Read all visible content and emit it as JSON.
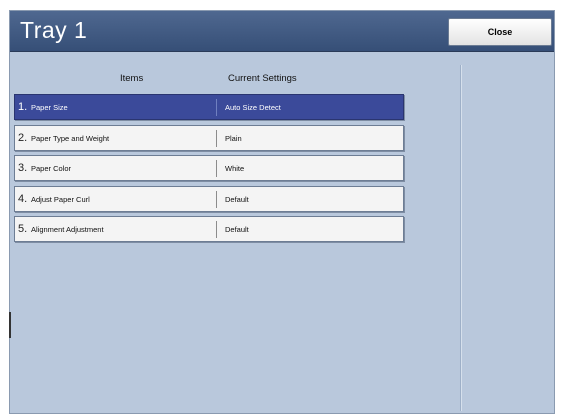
{
  "window": {
    "title": "Tray 1"
  },
  "toolbar": {
    "close_label": "Close"
  },
  "table": {
    "header_items": "Items",
    "header_current": "Current Settings",
    "rows": [
      {
        "num": "1.",
        "name": "Paper Size",
        "value": "Auto Size Detect",
        "selected": true
      },
      {
        "num": "2.",
        "name": "Paper Type and Weight",
        "value": "Plain",
        "selected": false
      },
      {
        "num": "3.",
        "name": "Paper Color",
        "value": "White",
        "selected": false
      },
      {
        "num": "4.",
        "name": "Adjust Paper Curl",
        "value": "Default",
        "selected": false
      },
      {
        "num": "5.",
        "name": "Alignment Adjustment",
        "value": "Default",
        "selected": false
      }
    ]
  },
  "colors": {
    "background": "#b9c8dc",
    "titlebar": "#3e5680",
    "selected_row": "#3b4a9a"
  }
}
